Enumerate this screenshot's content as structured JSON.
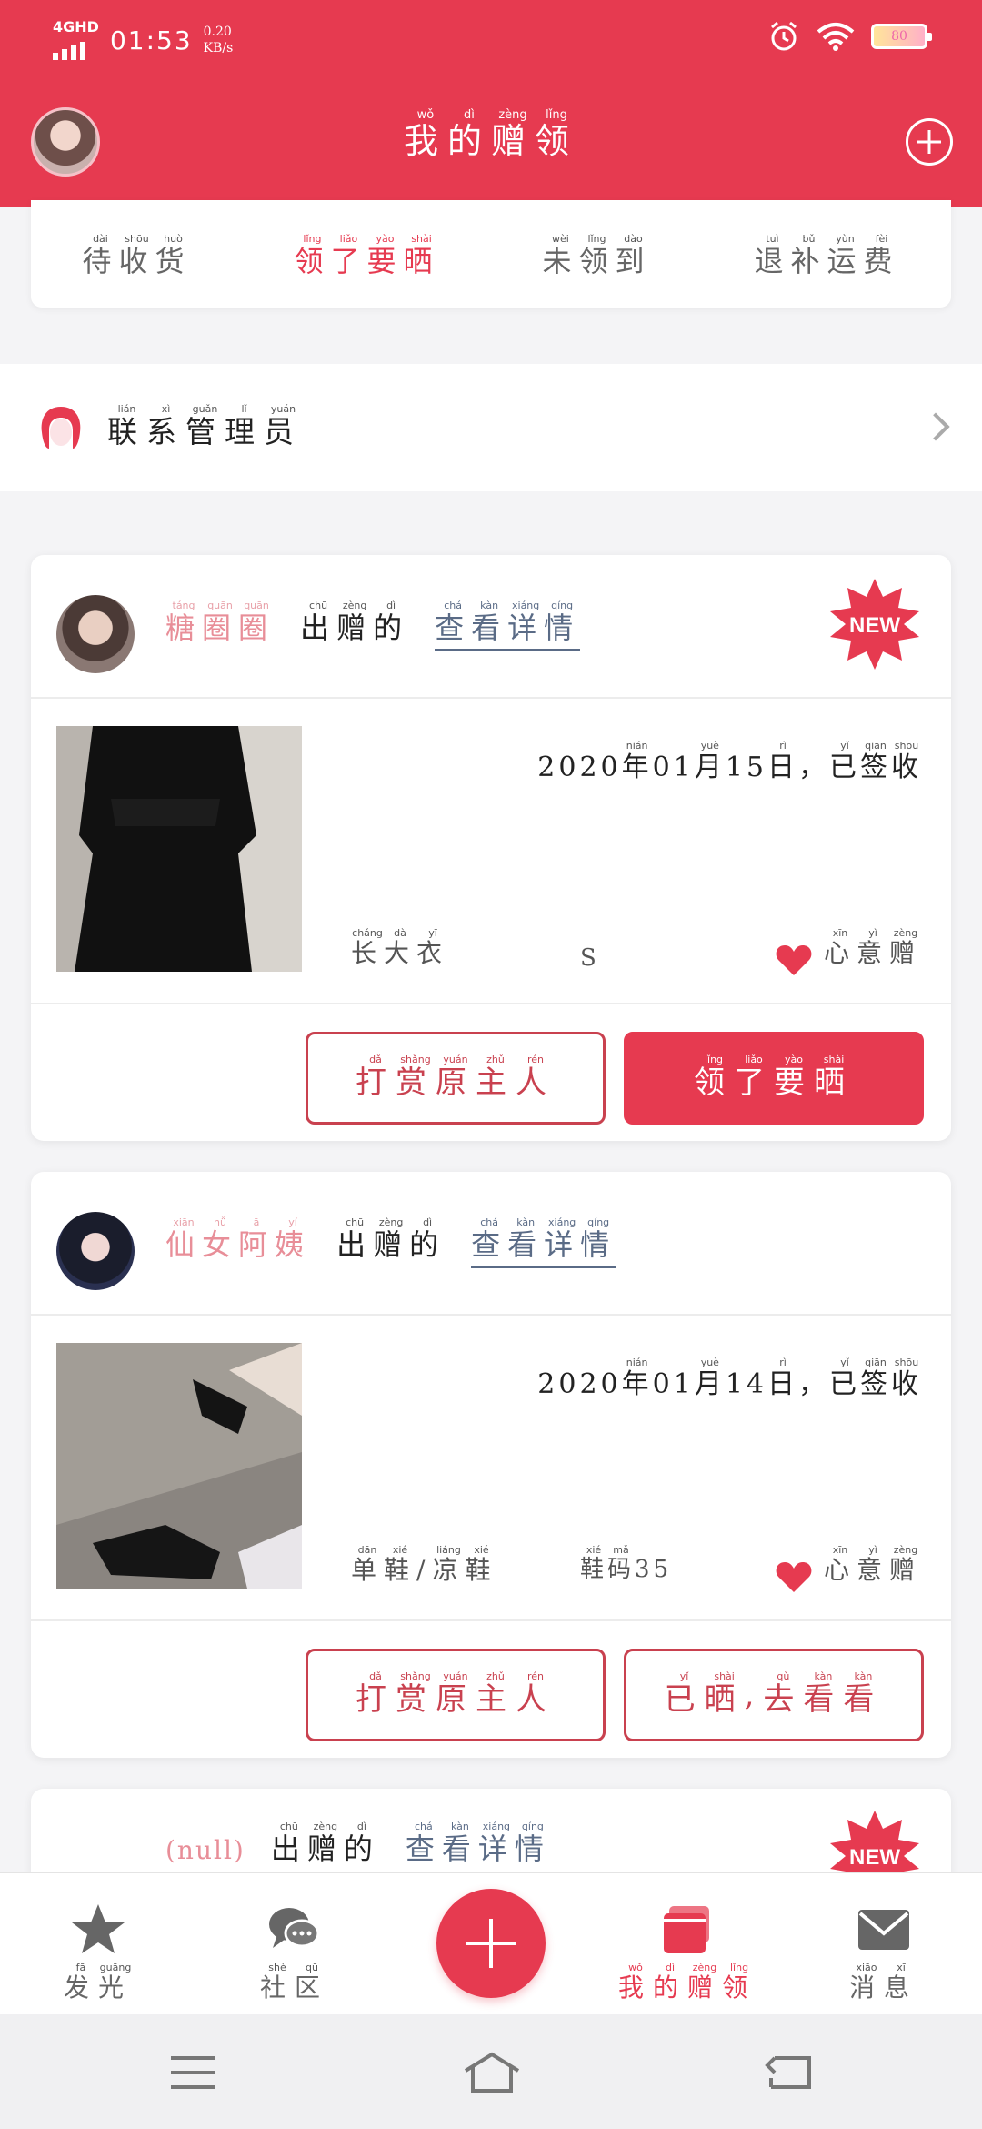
{
  "statusbar": {
    "network": "4GHD",
    "time": "01:53",
    "speed_value": "0.20",
    "speed_unit": "KB/s",
    "battery": "80"
  },
  "header": {
    "title": [
      [
        "我",
        "wǒ"
      ],
      [
        "的",
        "dì"
      ],
      [
        "赠",
        "zèng"
      ],
      [
        "领",
        "lǐng"
      ]
    ]
  },
  "tabs": [
    {
      "chars": [
        [
          "待",
          "dài"
        ],
        [
          "收",
          "shōu"
        ],
        [
          "货",
          "huò"
        ]
      ],
      "active": false
    },
    {
      "chars": [
        [
          "领",
          "lǐng"
        ],
        [
          "了",
          "liǎo"
        ],
        [
          "要",
          "yào"
        ],
        [
          "晒",
          "shài"
        ]
      ],
      "active": true
    },
    {
      "chars": [
        [
          "未",
          "wèi"
        ],
        [
          "领",
          "lǐng"
        ],
        [
          "到",
          "dào"
        ]
      ],
      "active": false
    },
    {
      "chars": [
        [
          "退",
          "tuì"
        ],
        [
          "补",
          "bǔ"
        ],
        [
          "运",
          "yùn"
        ],
        [
          "费",
          "fèi"
        ]
      ],
      "active": false
    }
  ],
  "admin": {
    "label": [
      [
        "联",
        "lián"
      ],
      [
        "系",
        "xì"
      ],
      [
        "管",
        "guǎn"
      ],
      [
        "理",
        "lǐ"
      ],
      [
        "员",
        "yuán"
      ]
    ]
  },
  "common": {
    "gives": [
      [
        "出",
        "chū"
      ],
      [
        "赠",
        "zèng"
      ],
      [
        "的",
        "dì"
      ]
    ],
    "detail": [
      [
        "查",
        "chá"
      ],
      [
        "看",
        "kàn"
      ],
      [
        "详",
        "xiáng"
      ],
      [
        "情",
        "qíng"
      ]
    ],
    "heart": [
      [
        "心",
        "xīn"
      ],
      [
        "意",
        "yì"
      ],
      [
        "赠",
        "zèng"
      ]
    ],
    "date_suffix": [
      [
        "已",
        "yǐ"
      ],
      [
        "签",
        "qiān"
      ],
      [
        "收",
        "shōu"
      ]
    ],
    "reward": [
      [
        "打",
        "dǎ"
      ],
      [
        "赏",
        "shǎng"
      ],
      [
        "原",
        "yuán"
      ],
      [
        "主",
        "zhǔ"
      ],
      [
        "人",
        "rén"
      ]
    ],
    "new_badge": "NEW",
    "year_char": [
      "年",
      "nián"
    ],
    "month_char": [
      "月",
      "yuè"
    ],
    "day_char": [
      "日",
      "rì"
    ]
  },
  "orders": [
    {
      "owner": [
        [
          "糖",
          "táng"
        ],
        [
          "圈",
          "quān"
        ],
        [
          "圈",
          "quān"
        ]
      ],
      "is_new": true,
      "year": "2020",
      "month": "01",
      "day": "15",
      "item": [
        [
          "长",
          "cháng"
        ],
        [
          "大",
          "dà"
        ],
        [
          "衣",
          "yī"
        ]
      ],
      "size": "S",
      "action": [
        [
          "领",
          "lǐng"
        ],
        [
          "了",
          "liǎo"
        ],
        [
          "要",
          "yào"
        ],
        [
          "晒",
          "shài"
        ]
      ],
      "action_solid": true
    },
    {
      "owner": [
        [
          "仙",
          "xiān"
        ],
        [
          "女",
          "nǚ"
        ],
        [
          "阿",
          "ā"
        ],
        [
          "姨",
          "yí"
        ]
      ],
      "is_new": false,
      "year": "2020",
      "month": "01",
      "day": "14",
      "item": [
        [
          "单",
          "dān"
        ],
        [
          "鞋",
          "xié"
        ],
        [
          "/",
          ""
        ],
        [
          "凉",
          "liáng"
        ],
        [
          "鞋",
          "xié"
        ]
      ],
      "size": "鞋码35",
      "size_ruby": [
        [
          "鞋",
          "xié"
        ],
        [
          "码",
          "mǎ"
        ],
        [
          "35",
          ""
        ]
      ],
      "action": [
        [
          "已",
          "yǐ"
        ],
        [
          "晒",
          "shài"
        ],
        [
          ",",
          ""
        ],
        [
          "去",
          "qù"
        ],
        [
          "看",
          "kàn"
        ],
        [
          "看",
          "kàn"
        ]
      ],
      "action_solid": false
    },
    {
      "owner_text": "(null)",
      "is_new": true
    }
  ],
  "nav": {
    "items": [
      {
        "chars": [
          [
            "发",
            "fā"
          ],
          [
            "光",
            "guāng"
          ]
        ],
        "icon": "star-icon",
        "active": false
      },
      {
        "chars": [
          [
            "社",
            "shè"
          ],
          [
            "区",
            "qū"
          ]
        ],
        "icon": "chat-bubbles-icon",
        "active": false
      },
      {
        "chars": [
          [
            "我",
            "wǒ"
          ],
          [
            "的",
            "dì"
          ],
          [
            "赠",
            "zèng"
          ],
          [
            "领",
            "lǐng"
          ]
        ],
        "icon": "gift-cards-icon",
        "active": true
      },
      {
        "chars": [
          [
            "消",
            "xiāo"
          ],
          [
            "息",
            "xī"
          ]
        ],
        "icon": "envelope-icon",
        "active": false
      }
    ]
  },
  "colors": {
    "accent": "#e63a50",
    "owner_name": "#e88e98",
    "link": "#5a6b86"
  }
}
